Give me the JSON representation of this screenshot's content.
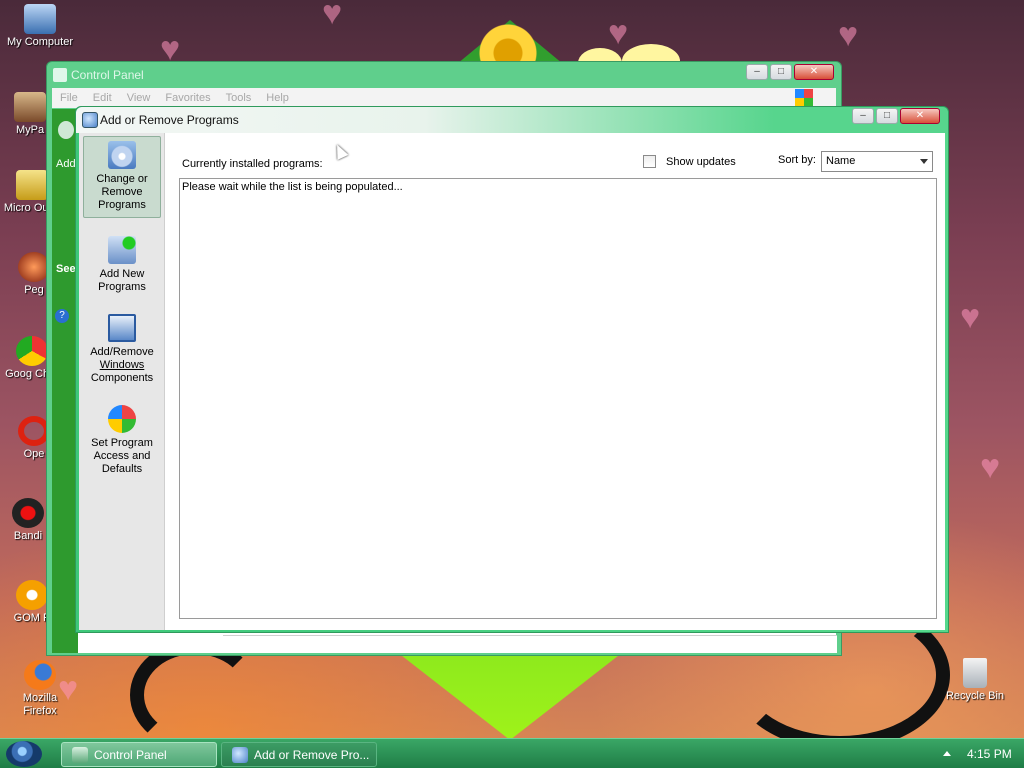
{
  "desktop": {
    "icons": [
      {
        "label": "My Computer",
        "icon": "computer-icon"
      },
      {
        "label": "MyPa",
        "icon": "user-folder-icon"
      },
      {
        "label": "Micro Outlo",
        "icon": "outlook-icon"
      },
      {
        "label": "Peg",
        "icon": "pegasus-icon"
      },
      {
        "label": "Goog Chro",
        "icon": "chrome-icon"
      },
      {
        "label": "Ope",
        "icon": "opera-icon"
      },
      {
        "label": "Bandi",
        "icon": "bandicam-icon"
      },
      {
        "label": "GOM P",
        "icon": "gom-player-icon"
      },
      {
        "label": "Mozilla Firefox",
        "icon": "firefox-icon"
      },
      {
        "label": "Recycle Bin",
        "icon": "recycle-bin-icon"
      }
    ]
  },
  "control_panel": {
    "title": "Control Panel",
    "menu": [
      "File",
      "Edit",
      "View",
      "Favorites",
      "Tools",
      "Help"
    ],
    "side_text_add": "Add",
    "side_text_see": "See"
  },
  "add_remove": {
    "title": "Add or Remove Programs",
    "sidebar": {
      "change_remove": [
        "Change or",
        "Remove",
        "Programs"
      ],
      "add_new": [
        "Add New",
        "Programs"
      ],
      "windows_components": [
        "Add/Remove",
        "Windows",
        "Components"
      ],
      "set_access": [
        "Set Program",
        "Access and",
        "Defaults"
      ]
    },
    "currently_installed_label": "Currently installed programs:",
    "show_updates_label": "Show updates",
    "sort_by_label": "Sort by:",
    "sort_by_value": "Name",
    "list_message": "Please wait while the list is being populated..."
  },
  "taskbar": {
    "buttons": [
      {
        "label": "Control Panel",
        "active": true
      },
      {
        "label": "Add or Remove Pro...",
        "active": false
      }
    ],
    "clock": "4:15 PM"
  },
  "colors": {
    "window_frame": "#56d88c",
    "taskbar": "#2a8f54",
    "desktop_green": "#3fbd2a"
  }
}
